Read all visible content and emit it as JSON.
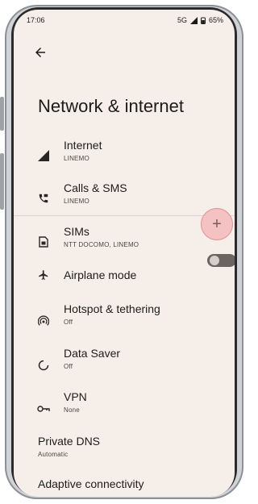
{
  "status_bar": {
    "time": "17:06",
    "network": "5G",
    "battery": "65%"
  },
  "page": {
    "title": "Network & internet"
  },
  "items": [
    {
      "label": "Internet",
      "sub": "LINEMO"
    },
    {
      "label": "Calls & SMS",
      "sub": "LINEMO"
    },
    {
      "label": "SIMs",
      "sub": "NTT DOCOMO, LINEMO"
    },
    {
      "label": "Airplane mode",
      "toggle_on": false
    },
    {
      "label": "Hotspot & tethering",
      "sub": "Off"
    },
    {
      "label": "Data Saver",
      "sub": "Off"
    },
    {
      "label": "VPN",
      "sub": "None"
    }
  ],
  "private_dns": {
    "label": "Private DNS",
    "sub": "Automatic"
  },
  "adaptive": {
    "label": "Adaptive connectivity"
  },
  "add_sim": {
    "symbol": "+"
  },
  "colors": {
    "background": "#f6efe9",
    "add_button": "#f4c2c2",
    "toggle_off": "#6b6562"
  }
}
